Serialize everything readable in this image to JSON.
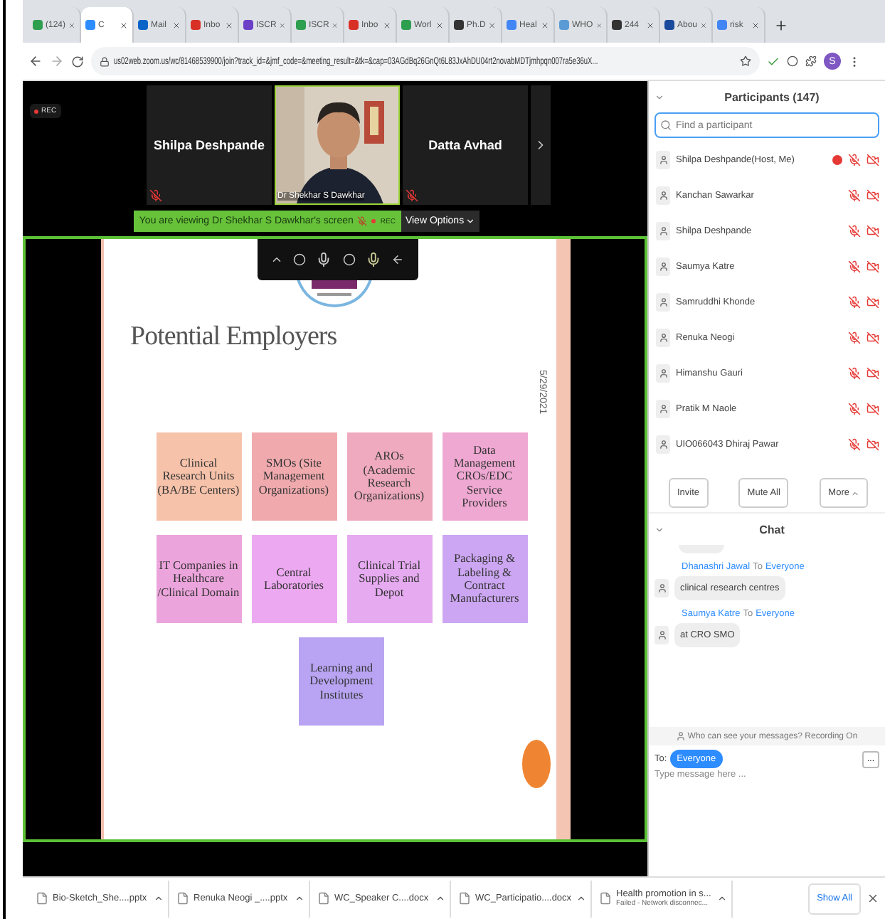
{
  "browser": {
    "tabs": [
      {
        "label": "(124)",
        "selected": false,
        "color": "#2e9e4f"
      },
      {
        "label": "C",
        "selected": true,
        "color": "#2d8cff"
      },
      {
        "label": "Mail",
        "selected": false,
        "color": "#0a64c8"
      },
      {
        "label": "Inbo",
        "selected": false,
        "color": "#d93025"
      },
      {
        "label": "ISCR",
        "selected": false,
        "color": "#6b3fc6"
      },
      {
        "label": "ISCR",
        "selected": false,
        "color": "#2e9e4f"
      },
      {
        "label": "Inbo",
        "selected": false,
        "color": "#d93025"
      },
      {
        "label": "Worl",
        "selected": false,
        "color": "#2e9e4f"
      },
      {
        "label": "Ph.D",
        "selected": false,
        "color": "#333333"
      },
      {
        "label": "Heal",
        "selected": false,
        "color": "#4285f4"
      },
      {
        "label": "WHO",
        "selected": false,
        "color": "#5b9bd5"
      },
      {
        "label": "244",
        "selected": false,
        "color": "#333333"
      },
      {
        "label": "Abou",
        "selected": false,
        "color": "#1a4a9c"
      },
      {
        "label": "risk",
        "selected": false,
        "color": "#4285f4"
      }
    ],
    "address": "us02web.zoom.us/wc/81468539900/join?track_id=&jmf_code=&meeting_result=&tk=&cap=03AGdBq26GnQt6L83JxAhDU04rt2novabMDTjmhpqn007ra5e36uX...",
    "profile": "S"
  },
  "meeting": {
    "rec": "REC",
    "tiles": [
      {
        "kind": "name",
        "name": "Shilpa Deshpande",
        "muted": true
      },
      {
        "kind": "video",
        "name": "Dr Shekhar S Dawkhar"
      },
      {
        "kind": "name",
        "name": "Datta Avhad",
        "muted": true
      }
    ],
    "banner": "You are viewing Dr Shekhar S Dawkhar's screen",
    "banner_rec": "REC",
    "view_options": "View Options"
  },
  "slide": {
    "title": "Potential Employers",
    "date": "5/29/2021",
    "boxes": [
      {
        "text": "Clinical Research Units (BA/BE Centers)",
        "color": "#f6c2aa"
      },
      {
        "text": "SMOs (Site Management Organizations)",
        "color": "#f0aaae"
      },
      {
        "text": "AROs (Academic Research Organizations)",
        "color": "#efaac0"
      },
      {
        "text": "Data Management CROs/EDC Service Providers",
        "color": "#efa8d2"
      },
      {
        "text": "IT Companies in Healthcare /Clinical Domain",
        "color": "#eca4dc"
      },
      {
        "text": "Central Laboratories",
        "color": "#eca8f0"
      },
      {
        "text": "Clinical Trial Supplies and Depot",
        "color": "#e6aaf0"
      },
      {
        "text": "Packaging & Labeling & Contract Manufacturers",
        "color": "#cca6f2"
      },
      {
        "text": "Learning and Development Institutes",
        "color": "#b8a4f2"
      }
    ]
  },
  "participants": {
    "title": "Participants (147)",
    "search_placeholder": "Find a participant",
    "items": [
      {
        "name": "Shilpa Deshpande(Host, Me)",
        "recording": true,
        "muted": true,
        "video": false
      },
      {
        "name": "Kanchan Sawarkar",
        "recording": false,
        "muted": true,
        "video": false
      },
      {
        "name": "Shilpa Deshpande",
        "recording": false,
        "muted": true,
        "video": false
      },
      {
        "name": "Saumya Katre",
        "recording": false,
        "muted": true,
        "video": false
      },
      {
        "name": "Samruddhi Khonde",
        "recording": false,
        "muted": true,
        "video": false
      },
      {
        "name": "Renuka Neogi",
        "recording": false,
        "muted": true,
        "video": false
      },
      {
        "name": "Himanshu Gauri",
        "recording": false,
        "muted": true,
        "video": false
      },
      {
        "name": "Pratik M Naole",
        "recording": false,
        "muted": true,
        "video": false
      },
      {
        "name": "UIO066043 Dhiraj Pawar",
        "recording": false,
        "muted": true,
        "video": false
      }
    ],
    "buttons": [
      {
        "label": "Invite",
        "kind": "plain"
      },
      {
        "label": "Mute All",
        "kind": "plain"
      },
      {
        "label": "More",
        "kind": "menu"
      }
    ]
  },
  "chat": {
    "title": "Chat",
    "messages": [
      {
        "sender": "Dhanashri Jawal",
        "to_word": "To",
        "recipient": "Everyone",
        "text": "clinical research centres"
      },
      {
        "sender": "Saumya Katre",
        "to_word": "To",
        "recipient": "Everyone",
        "text": "at CRO SMO"
      }
    ],
    "notice": "Who can see your messages? Recording On",
    "to_label": "To:",
    "to_value": "Everyone",
    "more": "...",
    "placeholder": "Type message here ..."
  },
  "downloads": {
    "items": [
      {
        "name": "Bio-Sketch_She....pptx"
      },
      {
        "name": "Renuka Neogi _....pptx"
      },
      {
        "name": "WC_Speaker C....docx"
      },
      {
        "name": "WC_Participatio....docx"
      },
      {
        "name": "Health promotion in s...",
        "status": "Failed - Network disconnec..."
      }
    ],
    "show_all": "Show All"
  }
}
